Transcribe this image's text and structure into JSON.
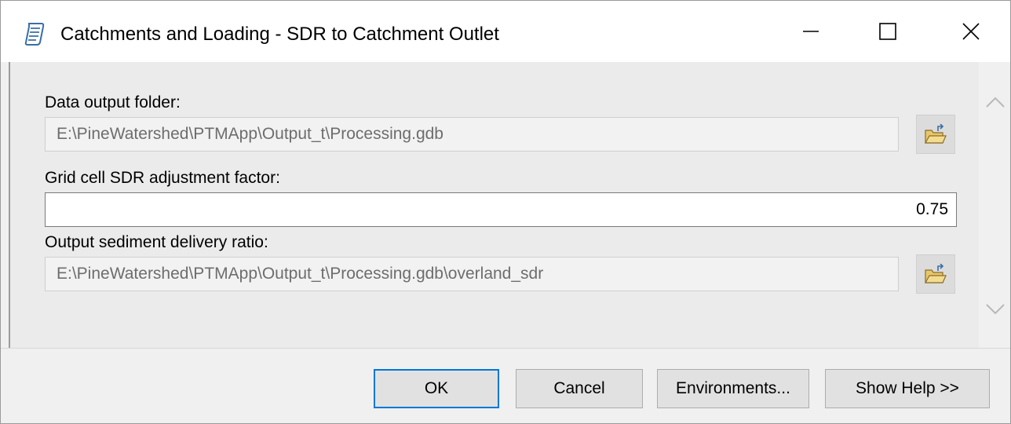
{
  "window": {
    "title": "Catchments and Loading - SDR to Catchment Outlet",
    "icon": "script-tool-icon"
  },
  "fields": {
    "data_output_folder": {
      "label": "Data output folder:",
      "value": "E:\\PineWatershed\\PTMApp\\Output_t\\Processing.gdb"
    },
    "sdr_adjustment": {
      "label": "Grid cell SDR adjustment factor:",
      "value": "0.75"
    },
    "output_sdr": {
      "label": "Output sediment delivery ratio:",
      "value": "E:\\PineWatershed\\PTMApp\\Output_t\\Processing.gdb\\overland_sdr"
    }
  },
  "buttons": {
    "ok": "OK",
    "cancel": "Cancel",
    "environments": "Environments...",
    "show_help": "Show Help >>"
  },
  "colors": {
    "default_button_border": "#0078d7",
    "folder_icon": "#e8c76a"
  }
}
